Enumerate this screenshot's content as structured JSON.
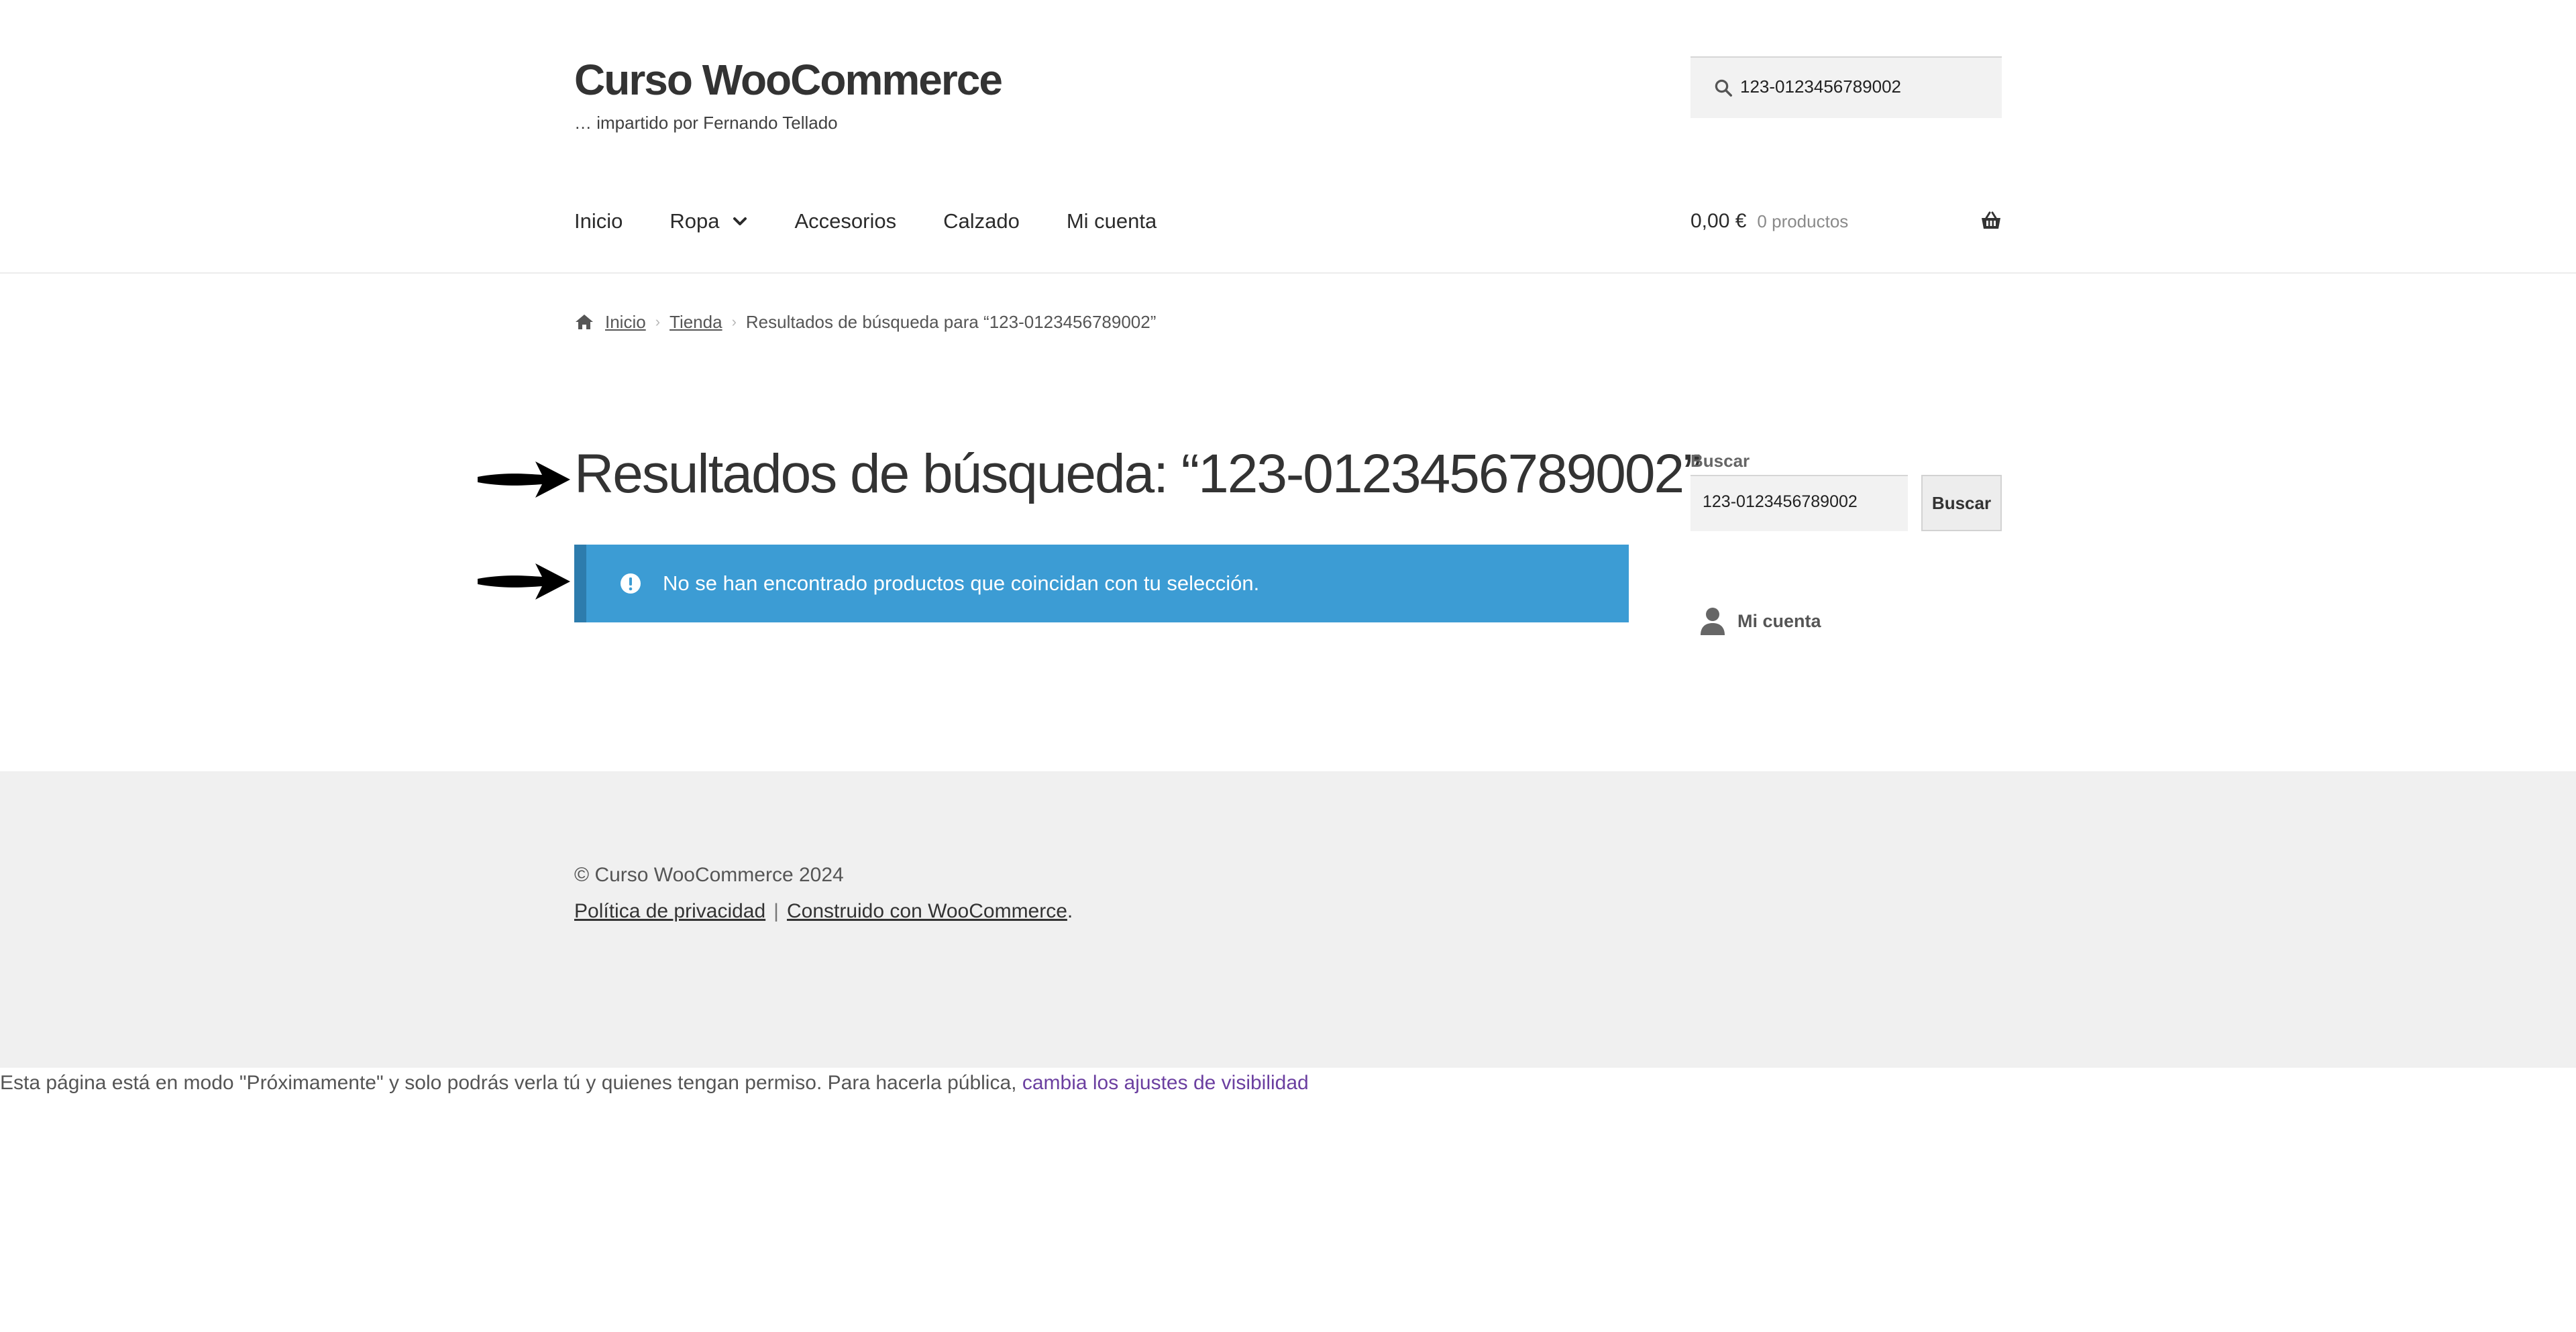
{
  "header": {
    "site_title": "Curso WooCommerce",
    "site_description": "… impartido por Fernando Tellado",
    "search_value": "123-0123456789002"
  },
  "nav": {
    "items": [
      {
        "label": "Inicio",
        "has_dropdown": false
      },
      {
        "label": "Ropa",
        "has_dropdown": true
      },
      {
        "label": "Accesorios",
        "has_dropdown": false
      },
      {
        "label": "Calzado",
        "has_dropdown": false
      },
      {
        "label": "Mi cuenta",
        "has_dropdown": false
      }
    ]
  },
  "cart": {
    "amount": "0,00 €",
    "count": "0 productos"
  },
  "breadcrumb": {
    "home": "Inicio",
    "shop": "Tienda",
    "current": "Resultados de búsqueda para “123-0123456789002”"
  },
  "main": {
    "title": "Resultados de búsqueda: “123-0123456789002”",
    "notice": "No se han encontrado productos que coincidan con tu selección."
  },
  "sidebar": {
    "search_label": "Buscar",
    "search_value": "123-0123456789002",
    "search_button": "Buscar",
    "account_link": "Mi cuenta"
  },
  "footer": {
    "copyright": "© Curso WooCommerce 2024",
    "privacy_link": "Política de privacidad",
    "separator": "|",
    "built_with_link": "Construido con WooCommerce",
    "period": "."
  },
  "coming_soon": {
    "text": "Esta página está en modo \"Próximamente\" y solo podrás verla tú y quienes tengan permiso. Para hacerla pública, ",
    "link": "cambia los ajustes de visibilidad"
  },
  "colors": {
    "notice_bg": "#3c9cd4",
    "notice_border": "#2d7cad",
    "footer_bg": "#f0f0f0",
    "link_purple": "#6b3fa0"
  }
}
